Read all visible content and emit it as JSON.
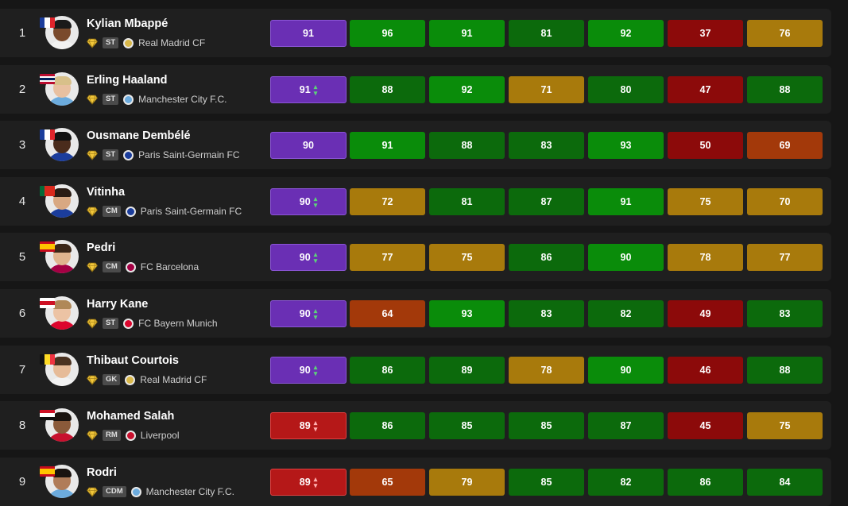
{
  "columns_note_colors": {
    "purple": "#6a2fb4",
    "red_ovr": "#b51818",
    "bright_green": "#0a8c0a",
    "dark_green": "#0c6a0c",
    "gold": "#a87a0c",
    "dark_red": "#8c0a0a",
    "burnt_orange": "#a3390a"
  },
  "players": [
    {
      "rank": "1",
      "name": "Kylian Mbappé",
      "position": "ST",
      "club": "Real Madrid CF",
      "club_icon_color": "#d9b84a",
      "flag": [
        "#1b3d9c",
        "#ffffff",
        "#e0242b"
      ],
      "flag_dir": "h",
      "skin": "#7a4a2c",
      "hair": "#1a1a1a",
      "shirt": "#f2f2f2",
      "gem": "#f2c73a",
      "ovr": "91",
      "ovr_color": "#6a2fb4",
      "ovr_border": "#8b55d6",
      "trend": "",
      "stats": [
        {
          "v": "96",
          "c": "#0a8c0a"
        },
        {
          "v": "91",
          "c": "#0a8c0a"
        },
        {
          "v": "81",
          "c": "#0c6a0c"
        },
        {
          "v": "92",
          "c": "#0a8c0a"
        },
        {
          "v": "37",
          "c": "#8c0a0a"
        },
        {
          "v": "76",
          "c": "#a87a0c"
        }
      ]
    },
    {
      "rank": "2",
      "name": "Erling Haaland",
      "position": "ST",
      "club": "Manchester City F.C.",
      "club_icon_color": "#6cabdd",
      "flag": [
        "#ba0c2f",
        "#ffffff",
        "#00205b",
        "#ffffff",
        "#ba0c2f"
      ],
      "flag_dir": "v",
      "skin": "#e8c0a0",
      "hair": "#d8c08a",
      "shirt": "#6cabdd",
      "gem": "#f2c73a",
      "ovr": "91",
      "ovr_color": "#6a2fb4",
      "ovr_border": "#8b55d6",
      "trend": "↑↓",
      "stats": [
        {
          "v": "88",
          "c": "#0c6a0c"
        },
        {
          "v": "92",
          "c": "#0a8c0a"
        },
        {
          "v": "71",
          "c": "#a87a0c"
        },
        {
          "v": "80",
          "c": "#0c6a0c"
        },
        {
          "v": "47",
          "c": "#8c0a0a"
        },
        {
          "v": "88",
          "c": "#0c6a0c"
        }
      ]
    },
    {
      "rank": "3",
      "name": "Ousmane Dembélé",
      "position": "ST",
      "club": "Paris Saint-Germain FC",
      "club_icon_color": "#1b3d9c",
      "flag": [
        "#1b3d9c",
        "#ffffff",
        "#e0242b"
      ],
      "flag_dir": "h",
      "skin": "#4a2c1c",
      "hair": "#111111",
      "shirt": "#1b3d9c",
      "gem": "#f2c73a",
      "ovr": "90",
      "ovr_color": "#6a2fb4",
      "ovr_border": "#8b55d6",
      "trend": "",
      "stats": [
        {
          "v": "91",
          "c": "#0a8c0a"
        },
        {
          "v": "88",
          "c": "#0c6a0c"
        },
        {
          "v": "83",
          "c": "#0c6a0c"
        },
        {
          "v": "93",
          "c": "#0a8c0a"
        },
        {
          "v": "50",
          "c": "#8c0a0a"
        },
        {
          "v": "69",
          "c": "#a3390a"
        }
      ]
    },
    {
      "rank": "4",
      "name": "Vitinha",
      "position": "CM",
      "club": "Paris Saint-Germain FC",
      "club_icon_color": "#1b3d9c",
      "flag": [
        "#046a38",
        "#da291c",
        "#da291c"
      ],
      "flag_dir": "h",
      "skin": "#d8a882",
      "hair": "#2a1c14",
      "shirt": "#1b3d9c",
      "gem": "#f2c73a",
      "ovr": "90",
      "ovr_color": "#6a2fb4",
      "ovr_border": "#8b55d6",
      "trend": "↑↓",
      "stats": [
        {
          "v": "72",
          "c": "#a87a0c"
        },
        {
          "v": "81",
          "c": "#0c6a0c"
        },
        {
          "v": "87",
          "c": "#0c6a0c"
        },
        {
          "v": "91",
          "c": "#0a8c0a"
        },
        {
          "v": "75",
          "c": "#a87a0c"
        },
        {
          "v": "70",
          "c": "#a87a0c"
        }
      ]
    },
    {
      "rank": "5",
      "name": "Pedri",
      "position": "CM",
      "club": "FC Barcelona",
      "club_icon_color": "#a50044",
      "flag": [
        "#c60b1e",
        "#ffc400",
        "#ffc400",
        "#c60b1e"
      ],
      "flag_dir": "v",
      "skin": "#e0b48e",
      "hair": "#3a2618",
      "shirt": "#a50044",
      "gem": "#f2c73a",
      "ovr": "90",
      "ovr_color": "#6a2fb4",
      "ovr_border": "#8b55d6",
      "trend": "↑↓",
      "stats": [
        {
          "v": "77",
          "c": "#a87a0c"
        },
        {
          "v": "75",
          "c": "#a87a0c"
        },
        {
          "v": "86",
          "c": "#0c6a0c"
        },
        {
          "v": "90",
          "c": "#0a8c0a"
        },
        {
          "v": "78",
          "c": "#a87a0c"
        },
        {
          "v": "77",
          "c": "#a87a0c"
        }
      ]
    },
    {
      "rank": "6",
      "name": "Harry Kane",
      "position": "ST",
      "club": "FC Bayern Munich",
      "club_icon_color": "#dc052d",
      "flag": [
        "#ffffff",
        "#ce1124",
        "#ffffff"
      ],
      "flag_dir": "v",
      "skin": "#ecc3a4",
      "hair": "#b08858",
      "shirt": "#dc052d",
      "gem": "#f2c73a",
      "ovr": "90",
      "ovr_color": "#6a2fb4",
      "ovr_border": "#8b55d6",
      "trend": "↑↓",
      "stats": [
        {
          "v": "64",
          "c": "#a3390a"
        },
        {
          "v": "93",
          "c": "#0a8c0a"
        },
        {
          "v": "83",
          "c": "#0c6a0c"
        },
        {
          "v": "82",
          "c": "#0c6a0c"
        },
        {
          "v": "49",
          "c": "#8c0a0a"
        },
        {
          "v": "83",
          "c": "#0c6a0c"
        }
      ]
    },
    {
      "rank": "7",
      "name": "Thibaut Courtois",
      "position": "GK",
      "club": "Real Madrid CF",
      "club_icon_color": "#d9b84a",
      "flag": [
        "#111111",
        "#fdda24",
        "#ef3340"
      ],
      "flag_dir": "h",
      "skin": "#e6bb98",
      "hair": "#4a3220",
      "shirt": "#f2f2f2",
      "gem": "#f2c73a",
      "ovr": "90",
      "ovr_color": "#6a2fb4",
      "ovr_border": "#8b55d6",
      "trend": "↑↓",
      "stats": [
        {
          "v": "86",
          "c": "#0c6a0c"
        },
        {
          "v": "89",
          "c": "#0c6a0c"
        },
        {
          "v": "78",
          "c": "#a87a0c"
        },
        {
          "v": "90",
          "c": "#0a8c0a"
        },
        {
          "v": "46",
          "c": "#8c0a0a"
        },
        {
          "v": "88",
          "c": "#0c6a0c"
        }
      ]
    },
    {
      "rank": "8",
      "name": "Mohamed Salah",
      "position": "RM",
      "club": "Liverpool",
      "club_icon_color": "#c8102e",
      "flag": [
        "#ce1126",
        "#ffffff",
        "#111111"
      ],
      "flag_dir": "v",
      "skin": "#8a5a3a",
      "hair": "#1a1410",
      "shirt": "#c8102e",
      "gem": "#f2c73a",
      "ovr": "89",
      "ovr_color": "#b51818",
      "ovr_border": "#e04040",
      "trend": "↑↓",
      "stats": [
        {
          "v": "86",
          "c": "#0c6a0c"
        },
        {
          "v": "85",
          "c": "#0c6a0c"
        },
        {
          "v": "85",
          "c": "#0c6a0c"
        },
        {
          "v": "87",
          "c": "#0c6a0c"
        },
        {
          "v": "45",
          "c": "#8c0a0a"
        },
        {
          "v": "75",
          "c": "#a87a0c"
        }
      ]
    },
    {
      "rank": "9",
      "name": "Rodri",
      "position": "CDM",
      "club": "Manchester City F.C.",
      "club_icon_color": "#6cabdd",
      "flag": [
        "#c60b1e",
        "#ffc400",
        "#ffc400",
        "#c60b1e"
      ],
      "flag_dir": "v",
      "skin": "#b07c58",
      "hair": "#1a1410",
      "shirt": "#6cabdd",
      "gem": "#f2c73a",
      "ovr": "89",
      "ovr_color": "#b51818",
      "ovr_border": "#e04040",
      "trend": "↑↓",
      "stats": [
        {
          "v": "65",
          "c": "#a3390a"
        },
        {
          "v": "79",
          "c": "#a87a0c"
        },
        {
          "v": "85",
          "c": "#0c6a0c"
        },
        {
          "v": "82",
          "c": "#0c6a0c"
        },
        {
          "v": "86",
          "c": "#0c6a0c"
        },
        {
          "v": "84",
          "c": "#0c6a0c"
        }
      ]
    }
  ]
}
